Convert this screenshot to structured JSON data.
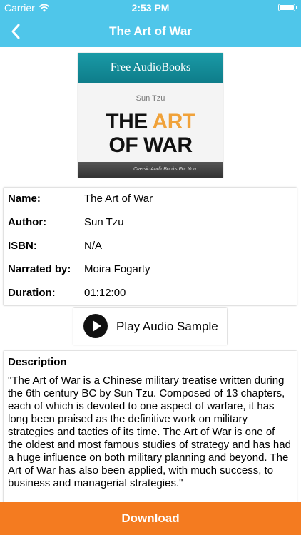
{
  "status_bar": {
    "carrier": "Carrier",
    "time": "2:53 PM"
  },
  "nav": {
    "title": "The Art of War"
  },
  "cover": {
    "banner": "Free AudioBooks",
    "author": "Sun Tzu",
    "title_line1_plain": "THE ",
    "title_line1_accent": "ART",
    "title_line2": "OF WAR",
    "tagline": "Classic AudioBooks For You",
    "accent_color": "#f0a23a",
    "banner_color": "#138b97"
  },
  "details": {
    "name_label": "Name:",
    "name_value": "The Art of War",
    "author_label": "Author:",
    "author_value": "Sun Tzu",
    "isbn_label": "ISBN:",
    "isbn_value": "N/A",
    "narrator_label": "Narrated by:",
    "narrator_value": "Moira Fogarty",
    "duration_label": "Duration:",
    "duration_value": "01:12:00"
  },
  "sample": {
    "label": "Play Audio Sample"
  },
  "description": {
    "heading": "Description",
    "text": "\"The Art of War is a Chinese military treatise written during the 6th century BC by Sun Tzu. Composed of 13 chapters, each of which is devoted to one aspect of warfare, it has long been praised as the definitive work on military strategies and tactics of its time. The Art of War is one of the oldest and most famous studies of strategy and has had a huge influence on both military planning and beyond. The Art of War has also been applied, with much success, to business and managerial strategies.\""
  },
  "download": {
    "label": "Download",
    "color": "#f47b20"
  },
  "theme": {
    "header_color": "#4fc6ea"
  },
  "icons": {
    "wifi": "wifi-icon",
    "battery": "battery-icon",
    "back": "chevron-left-icon",
    "play": "play-icon"
  }
}
